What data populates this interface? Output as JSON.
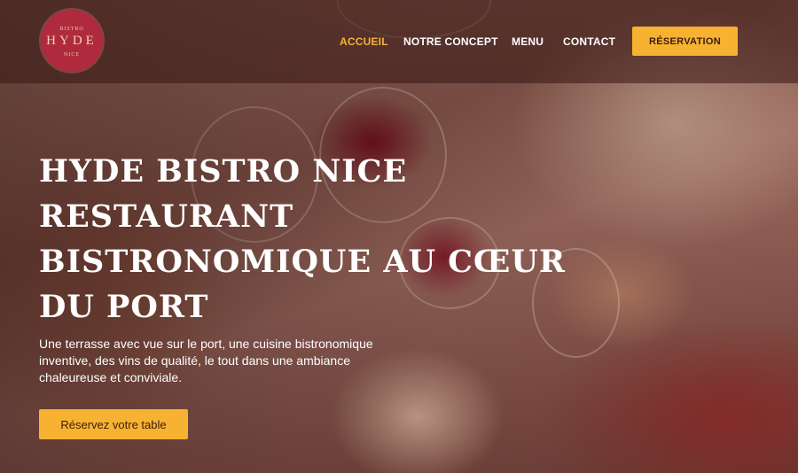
{
  "logo": {
    "top_text": "BISTRO",
    "name": "HYDE",
    "bottom_text": "NICE"
  },
  "nav": {
    "items": [
      {
        "label": "ACCUEIL",
        "active": true
      },
      {
        "label": "NOTRE CONCEPT",
        "active": false
      },
      {
        "label": "MENU",
        "active": false
      },
      {
        "label": "CONTACT",
        "active": false
      }
    ],
    "reservation_label": "RÉSERVATION"
  },
  "hero": {
    "title_lines": [
      "HYDE BISTRO NICE",
      "RESTAURANT",
      "BISTRONOMIQUE AU CŒUR",
      "DU PORT"
    ],
    "description": "Une terrasse avec vue sur le port, une cuisine bistronomique inventive, des vins de qualité, le tout dans une ambiance chaleureuse et conviviale.",
    "cta_label": "Réservez votre table"
  },
  "colors": {
    "accent": "#f7b231",
    "active_nav": "#f6b23a",
    "logo_bg": "#b02a3e"
  }
}
